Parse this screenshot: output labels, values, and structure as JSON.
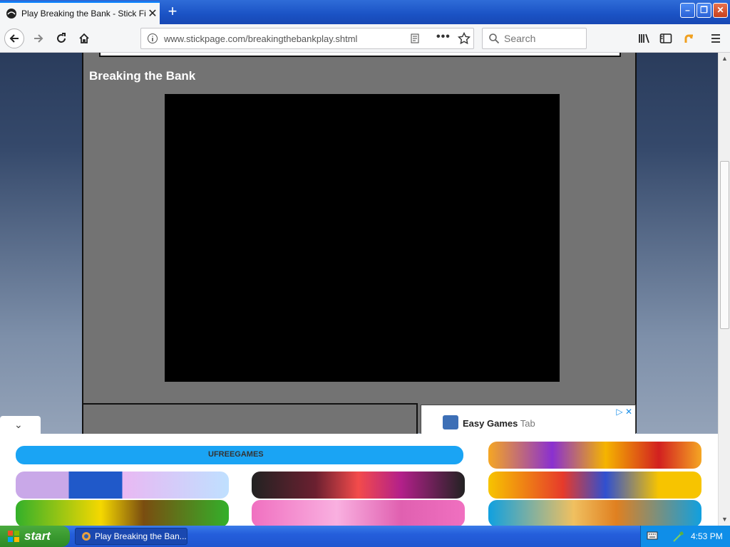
{
  "browser": {
    "tab_title": "Play Breaking the Bank - Stick Figu",
    "tab_close": "✕",
    "new_tab": "+",
    "url": "www.stickpage.com/breakingthebankplay.shtml",
    "url_more": "•••",
    "search_placeholder": "Search",
    "window": {
      "minimize": "–",
      "maximize": "❐",
      "close": "✕"
    }
  },
  "page": {
    "game_title": "Breaking the Bank",
    "ad": {
      "title_bold": "Easy Games",
      "title_rest": "Tab",
      "adchoice": "▷ ✕"
    },
    "bottom_ad": {
      "collapse_label": "⌄",
      "banner_text": "UFREEGAMES"
    }
  },
  "taskbar": {
    "start_label": "start",
    "task_item": "Play Breaking the Ban...",
    "clock": "4:53 PM"
  },
  "icons": {
    "favicon": "stickpage-icon",
    "info": "info-icon",
    "reader": "reader-view-icon",
    "star": "bookmark-star-icon",
    "search": "search-icon",
    "library": "library-icon",
    "sidebar": "sidebar-icon",
    "menu": "hamburger-menu-icon"
  }
}
